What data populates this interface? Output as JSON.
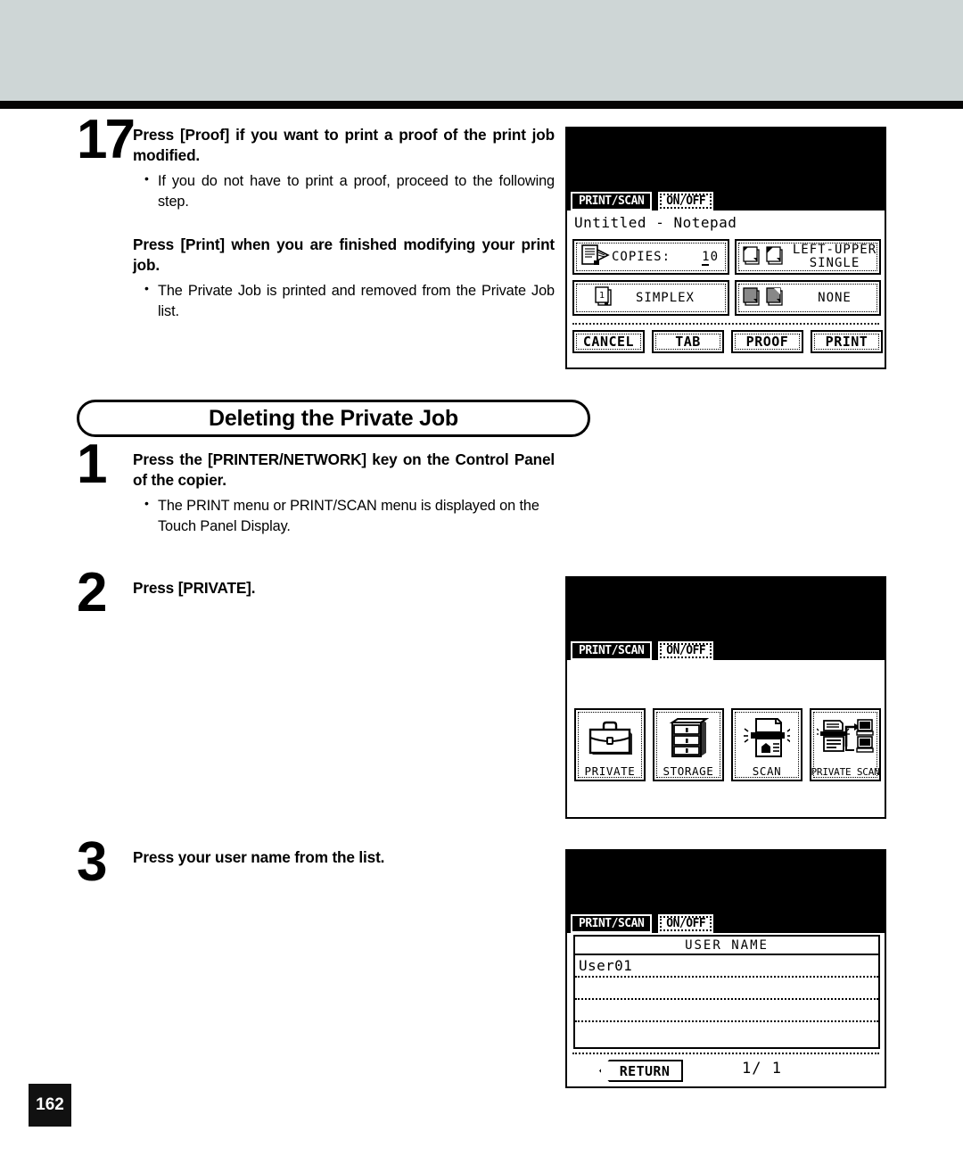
{
  "page": {
    "number": "162"
  },
  "section": {
    "title": "Deleting the Private Job"
  },
  "steps": [
    {
      "num": "17",
      "heading": "Press [Proof] if you want to print a proof of the print job modified.",
      "bullet": "If you do not have to print a proof, proceed to the following step.",
      "heading2": "Press [Print] when you are finished modifying your print job.",
      "bullet2": "The Private Job is printed and removed from the Private Job list."
    },
    {
      "num": "1",
      "heading": "Press the [PRINTER/NETWORK] key on the Control Panel of the copier.",
      "bullet": "The PRINT menu or PRINT/SCAN menu is displayed on the Touch Panel Display."
    },
    {
      "num": "2",
      "heading": "Press [PRIVATE]."
    },
    {
      "num": "3",
      "heading": "Press your user name from the list."
    }
  ],
  "panel1": {
    "tabs": [
      {
        "label": "PRINT/SCAN",
        "selected": true
      },
      {
        "label": "ON/OFF",
        "selected": false
      }
    ],
    "doc_title": "Untitled - Notepad",
    "settings": {
      "copies_label": "COPIES:",
      "copies_value": "10",
      "duplex": "SIMPLEX",
      "staple_line1": "LEFT-UPPER",
      "staple_line2": "SINGLE",
      "finishing": "NONE"
    },
    "buttons": [
      "CANCEL",
      "TAB",
      "PROOF",
      "PRINT"
    ]
  },
  "panel2": {
    "tabs": [
      {
        "label": "PRINT/SCAN",
        "selected": true
      },
      {
        "label": "ON/OFF",
        "selected": false
      }
    ],
    "icons": [
      {
        "label": "PRIVATE",
        "icon": "briefcase-icon"
      },
      {
        "label": "STORAGE",
        "icon": "file-cabinet-icon"
      },
      {
        "label": "SCAN",
        "icon": "scanner-icon"
      },
      {
        "label": "PRIVATE SCAN",
        "icon": "private-scan-icon"
      }
    ]
  },
  "panel3": {
    "tabs": [
      {
        "label": "PRINT/SCAN",
        "selected": true
      },
      {
        "label": "ON/OFF",
        "selected": false
      }
    ],
    "list_header": "USER NAME",
    "rows": [
      "User01",
      "",
      "",
      ""
    ],
    "return_label": "RETURN",
    "page_indicator": "1/ 1"
  },
  "colors": {
    "header_band": "#ced6d6",
    "rule": "#050505",
    "ink": "#000000",
    "paper": "#ffffff"
  }
}
